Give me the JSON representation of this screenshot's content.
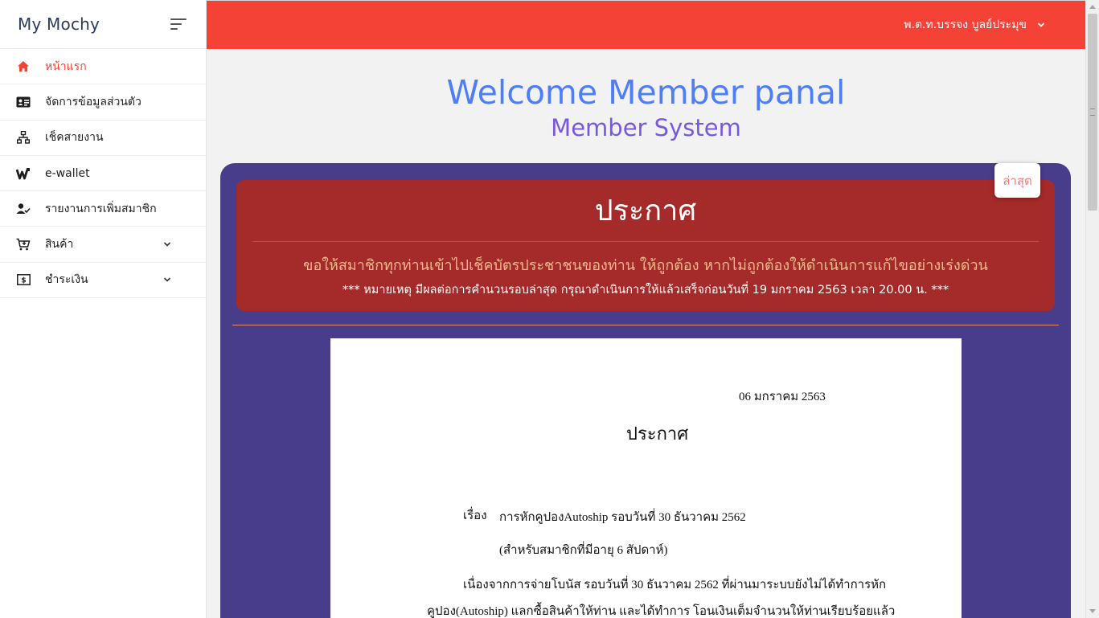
{
  "sidebar": {
    "brand": "My Mochy",
    "items": [
      {
        "label": "หน้าแรก",
        "icon": "home-icon",
        "active": true
      },
      {
        "label": "จัดการข้อมูลส่วนตัว",
        "icon": "id-card-icon"
      },
      {
        "label": "เช็คสายงาน",
        "icon": "sitemap-icon"
      },
      {
        "label": "e-wallet",
        "icon": "wallet-icon"
      },
      {
        "label": "รายงานการเพิ่มสมาชิก",
        "icon": "user-check-icon"
      },
      {
        "label": "สินค้า",
        "icon": "cart-icon",
        "expandable": true
      },
      {
        "label": "ชำระเงิน",
        "icon": "money-icon",
        "expandable": true
      }
    ]
  },
  "topbar": {
    "user_name": "พ.ต.ท.บรรจง บูลย์ประมุข",
    "accent_color": "#f44336"
  },
  "welcome": {
    "title": "Welcome Member panal",
    "subtitle": "Member System"
  },
  "panel": {
    "latest_label": "ล่าสุด",
    "announcement": {
      "title": "ประกาศ",
      "message": "ขอให้สมาชิกทุกท่านเข้าไปเช็คบัตรประชาชนของท่าน ให้ถูกต้อง หากไม่ถูกต้องให้ดำเนินการแก้ไขอย่างเร่งด่วน",
      "note": "*** หมายเหตุ มีผลต่อการคำนวนรอบล่าสุด กรุณาดำเนินการให้แล้วเสร็จก่อนวันที่ 19 มกราคม 2563 เวลา 20.00 น. ***"
    },
    "document": {
      "date": "06 มกราคม 2563",
      "title": "ประกาศ",
      "subject_label": "เรื่อง",
      "subject": "การหักคูปองAutoship รอบวันที่ 30 ธันวาคม 2562",
      "note": "(สำหรับสมาชิกที่มีอายุ 6 สัปดาห์)",
      "body_line1": "เนื่องจากการจ่ายโบนัส รอบวันที่ 30 ธันวาคม 2562 ที่ผ่านมาระบบยังไม่ได้ทำการหัก",
      "body_line2": "คูปอง(Autoship) แลกซื้อสินค้าให้ท่าน และได้ทำการ โอนเงินเต็มจำนวนให้ท่านเรียบร้อยแล้ว"
    }
  }
}
